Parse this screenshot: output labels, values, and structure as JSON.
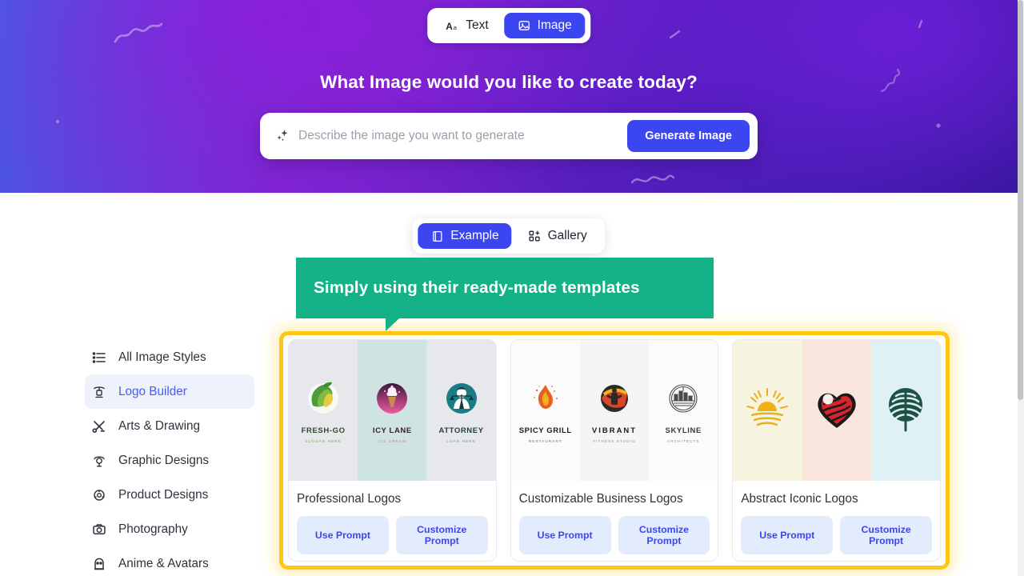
{
  "hero": {
    "title": "What Image would you like to create today?",
    "mode_tabs": [
      {
        "label": "Text",
        "icon": "text-format-icon",
        "active": false
      },
      {
        "label": "Image",
        "icon": "image-icon",
        "active": true
      }
    ],
    "search": {
      "placeholder": "Describe the image you want to generate",
      "value": "",
      "icon": "sparkle-icon",
      "button_label": "Generate Image"
    },
    "colors": {
      "accent": "#3b46f1",
      "gradient_start": "#3f63e8",
      "gradient_end": "#141078"
    }
  },
  "content_tabs": [
    {
      "label": "Example",
      "icon": "book-icon",
      "active": true
    },
    {
      "label": "Gallery",
      "icon": "grid-plus-icon",
      "active": false
    }
  ],
  "callout": {
    "text": "Simply using their ready-made templates",
    "color": "#16b287"
  },
  "sidebar": {
    "items": [
      {
        "label": "All Image Styles",
        "icon": "list-icon",
        "active": false
      },
      {
        "label": "Logo Builder",
        "icon": "logo-stamp-icon",
        "active": true
      },
      {
        "label": "Arts & Drawing",
        "icon": "brush-pencil-icon",
        "active": false
      },
      {
        "label": "Graphic Designs",
        "icon": "lamp-icon",
        "active": false
      },
      {
        "label": "Product Designs",
        "icon": "product-atom-icon",
        "active": false
      },
      {
        "label": "Photography",
        "icon": "camera-icon",
        "active": false
      },
      {
        "label": "Anime & Avatars",
        "icon": "anime-avatar-icon",
        "active": false
      }
    ]
  },
  "highlight": {
    "color": "#ffc715"
  },
  "cards": [
    {
      "title": "Professional Logos",
      "buttons": {
        "use": "Use Prompt",
        "customize": "Customize Prompt"
      },
      "panels": [
        {
          "bg": "#e6e8ec",
          "name": "FRESH-GO",
          "sub": "SLOGAN HERE",
          "name_color": "#2f4a2c",
          "sub_color": "#7d9a6a",
          "icon": "leaf-lemon-logo-icon"
        },
        {
          "bg": "#cfe3e2",
          "name": "ICY LANE",
          "sub": "ICE CREAM",
          "name_color": "#3a2030",
          "sub_color": "#d4719c",
          "icon": "ice-cream-logo-icon"
        },
        {
          "bg": "#e6e8ec",
          "name": "ATTORNEY",
          "sub": "LOAN HERE",
          "name_color": "#1f3b46",
          "sub_color": "#6f8e96",
          "icon": "attorney-scales-logo-icon"
        }
      ]
    },
    {
      "title": "Customizable Business Logos",
      "buttons": {
        "use": "Use Prompt",
        "customize": "Customize Prompt"
      },
      "panels": [
        {
          "bg": "#fbfbfc",
          "name": "SPICY GRILL",
          "sub": "RESTAURANT",
          "name_color": "#1b1b1b",
          "sub_color": "#6a6a6a",
          "icon": "flame-logo-icon"
        },
        {
          "bg": "#f5f5f7",
          "name": "VIBRANT",
          "sub": "FITNESS STUDIO",
          "name_color": "#1b1b1b",
          "sub_color": "#8a8a8a",
          "icon": "fitness-logo-icon"
        },
        {
          "bg": "#fbfbfc",
          "name": "SKYLINE",
          "sub": "ARCHITECTS",
          "name_color": "#3a3a3a",
          "sub_color": "#8a8a8a",
          "icon": "skyline-logo-icon"
        }
      ]
    },
    {
      "title": "Abstract Iconic Logos",
      "buttons": {
        "use": "Use Prompt",
        "customize": "Customize Prompt"
      },
      "panels": [
        {
          "bg": "#f6f4df",
          "name": "",
          "sub": "",
          "name_color": "#e8a81c",
          "sub_color": "#e8a81c",
          "icon": "sunrise-logo-icon"
        },
        {
          "bg": "#fbe6dd",
          "name": "",
          "sub": "",
          "name_color": "#d92d2d",
          "sub_color": "#d92d2d",
          "icon": "heart-logo-icon"
        },
        {
          "bg": "#dff1f5",
          "name": "",
          "sub": "",
          "name_color": "#2a5c4c",
          "sub_color": "#2a5c4c",
          "icon": "tree-logo-icon"
        }
      ]
    }
  ]
}
